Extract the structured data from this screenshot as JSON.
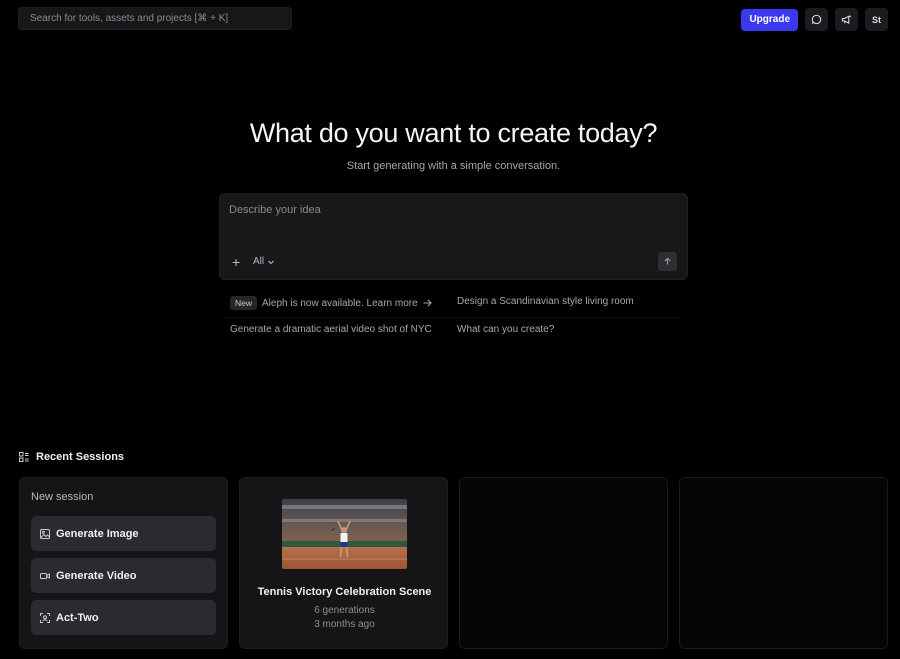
{
  "search": {
    "placeholder": "Search for tools, assets and projects [⌘ + K]"
  },
  "topbar": {
    "upgrade_label": "Upgrade",
    "icons": [
      "chat-icon",
      "megaphone-icon"
    ],
    "avatar_initials": "St"
  },
  "hero": {
    "title": "What do you want to create today?",
    "subtitle": "Start generating with a simple conversation."
  },
  "prompt": {
    "placeholder": "Describe your idea",
    "add_label": "+",
    "filter_label": "All"
  },
  "suggestions": {
    "new_badge": "New",
    "announcement": "Aleph is now available. Learn more",
    "items": [
      "Design a Scandinavian style living room",
      "Generate a dramatic aerial video shot of NYC",
      "What can you create?"
    ]
  },
  "recent": {
    "heading": "Recent Sessions",
    "new_session": {
      "title": "New session",
      "buttons": [
        "Generate Image",
        "Generate Video",
        "Act-Two"
      ]
    },
    "sessions": [
      {
        "title": "Tennis Victory Celebration Scene",
        "generations": "6 generations",
        "age": "3 months ago"
      }
    ]
  },
  "colors": {
    "accent": "#3b39f0",
    "background": "#000000",
    "card": "#151518"
  }
}
